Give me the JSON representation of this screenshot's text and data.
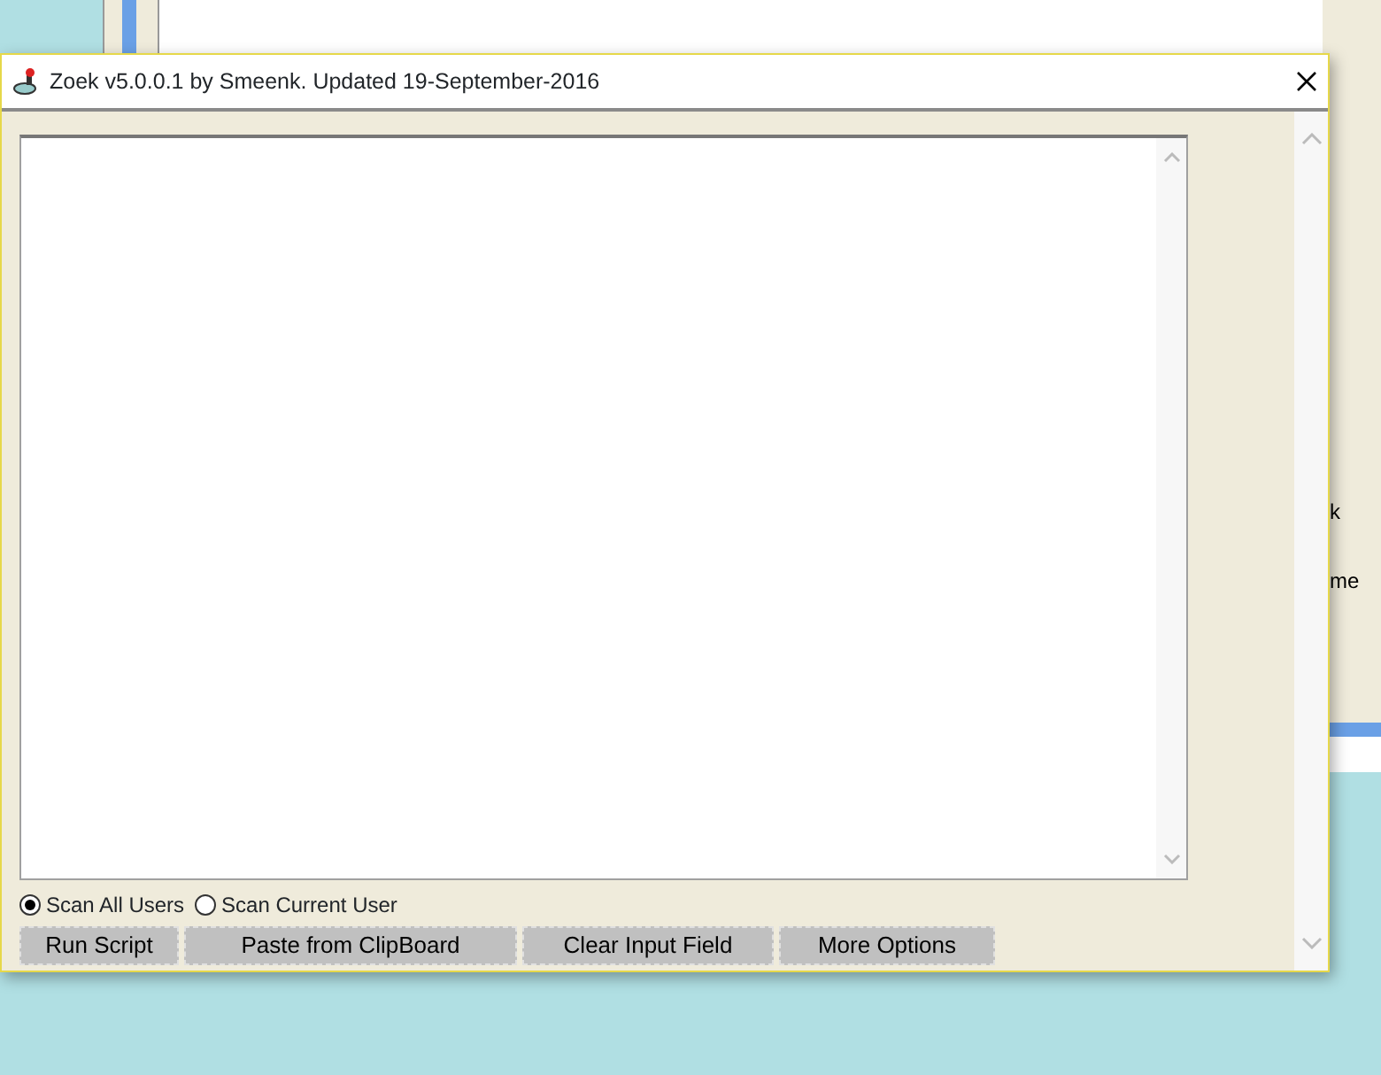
{
  "background_window": {
    "texts": [
      "k",
      "me"
    ]
  },
  "window": {
    "title": "Zoek v5.0.0.1 by Smeenk. Updated 19-September-2016"
  },
  "scan_options": [
    {
      "label": "Scan All Users",
      "selected": true
    },
    {
      "label": "Scan Current User",
      "selected": false
    }
  ],
  "buttons": [
    "Run Script",
    "Paste from ClipBoard",
    "Clear Input Field",
    "More Options"
  ]
}
